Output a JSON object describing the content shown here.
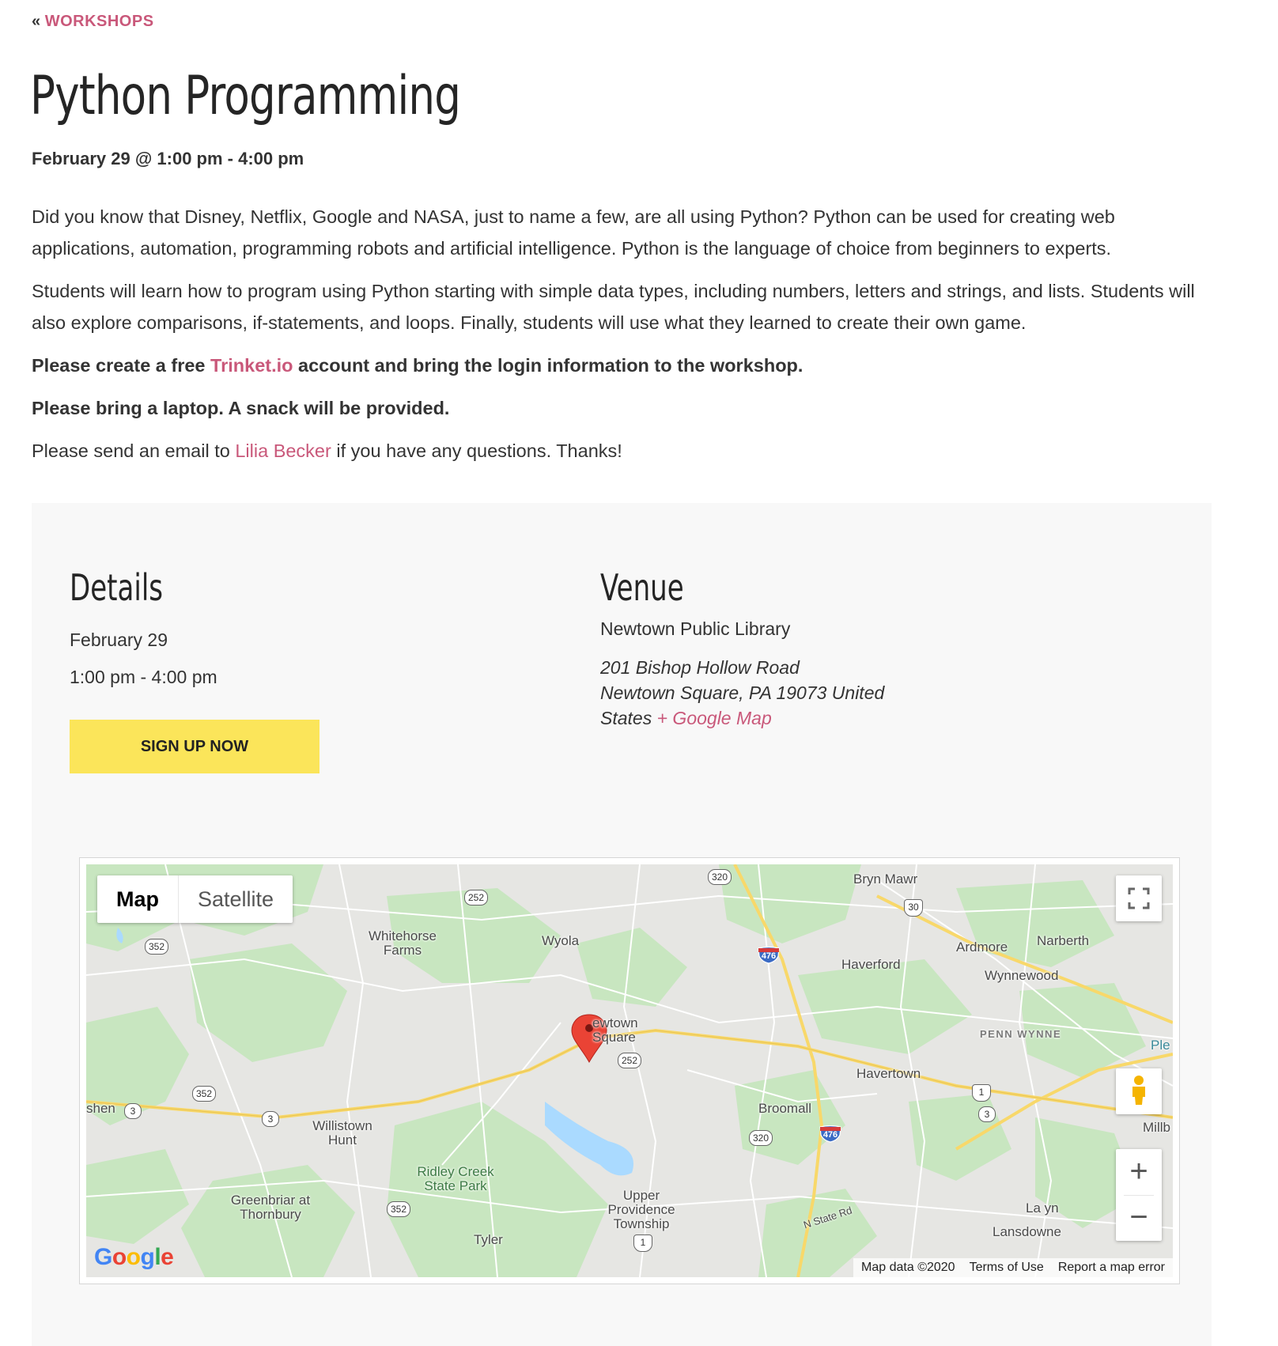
{
  "breadcrumb": {
    "prefix": "«",
    "label": "WORKSHOPS"
  },
  "event": {
    "title": "Python Programming",
    "datetime": "February 29 @ 1:00 pm - 4:00 pm",
    "paragraph1": "Did you know that Disney, Netflix, Google and NASA, just to name a few, are all using Python? Python can be used for creating web applications, automation, programming robots and artificial intelligence. Python is the language of choice from beginners to experts.",
    "paragraph2": "Students will learn how to program using Python starting with simple data types, including numbers, letters and strings, and lists. Students will also explore comparisons, if-statements, and loops. Finally, students will use what they learned to create their own game.",
    "p3_before": "Please create a free ",
    "p3_link": "Trinket.io",
    "p3_after": " account and bring the login information to the workshop.",
    "p4": "Please bring a laptop. A snack will be provided.",
    "p5_before": "Please send an email to ",
    "p5_link": "Lilia Becker",
    "p5_after": " if you have any questions. Thanks!"
  },
  "details": {
    "heading": "Details",
    "date": "February 29",
    "time": "1:00 pm - 4:00 pm",
    "signup_label": "SIGN UP NOW"
  },
  "venue": {
    "heading": "Venue",
    "name": "Newtown Public Library",
    "address_line1": "201 Bishop Hollow Road",
    "address_line2": "Newtown Square, PA 19073 United",
    "address_line3": "States",
    "map_link": "+ Google Map"
  },
  "map": {
    "type_map": "Map",
    "type_satellite": "Satellite",
    "zoom_in": "+",
    "zoom_out": "−",
    "logo": "Google",
    "attribution": [
      "Map data ©2020",
      "Terms of Use",
      "Report a map error"
    ],
    "places": {
      "bryn_mawr": "Bryn Mawr",
      "narberth": "Narberth",
      "ardmore": "Ardmore",
      "wyola": "Wyola",
      "whitehorse_farms": "Whitehorse Farms",
      "haverford": "Haverford",
      "wynnewood": "Wynnewood",
      "penn_wynne": "PENN WYNNE",
      "newtown_square": "ewtown Square",
      "havertown": "Havertown",
      "broomall": "Broomall",
      "willistown_hunt": "Willistown Hunt",
      "ridley_creek": "Ridley Creek State Park",
      "greenbriar": "Greenbriar at Thornbury",
      "upper_providence": "Upper Providence Township",
      "tyler": "Tyler",
      "lansdowne": "Lansdowne",
      "n_state_rd": "N State Rd",
      "shen": "shen",
      "ple": "Ple",
      "millb": "Millb",
      "la_yn": "La      yn"
    },
    "shields": {
      "r320a": "320",
      "r252a": "252",
      "r352a": "352",
      "r30": "30",
      "i476a": "476",
      "r252b": "252",
      "r352b": "352",
      "r3a": "3",
      "r3b": "3",
      "us1a": "1",
      "r3c": "3",
      "r320b": "320",
      "i476b": "476",
      "r352c": "352",
      "us1b": "1"
    },
    "colors": {
      "land": "#e6e6e3",
      "park": "#c8e6c0",
      "water": "#aadaff",
      "highway": "#f8d86a",
      "marker": "#ea4335"
    }
  },
  "colors": {
    "accent": "#c9587a",
    "button": "#fbe55a",
    "panel": "#f8f8f8"
  }
}
